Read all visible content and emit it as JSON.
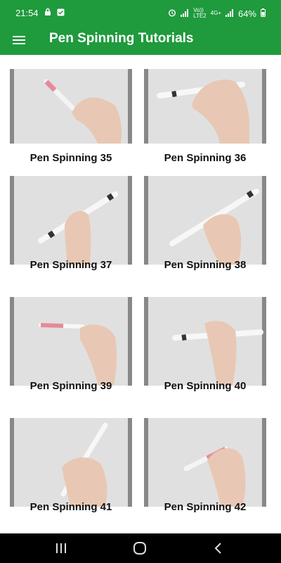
{
  "status_bar": {
    "time": "21:54",
    "network_top": "Vo))",
    "network_bottom": "LTE2",
    "gen_top": "4G+",
    "battery": "64%"
  },
  "app_bar": {
    "title": "Pen Spinning Tutorials",
    "menu_icon": "hamburger-menu-icon"
  },
  "videos": [
    {
      "title": "Pen Spinning 35"
    },
    {
      "title": "Pen Spinning 36"
    },
    {
      "title": "Pen Spinning 37"
    },
    {
      "title": "Pen Spinning 38"
    },
    {
      "title": "Pen Spinning 39"
    },
    {
      "title": "Pen Spinning 40"
    },
    {
      "title": "Pen Spinning 41"
    },
    {
      "title": "Pen Spinning 42"
    }
  ],
  "nav_bar": {
    "recents_icon": "recents-icon",
    "home_icon": "home-icon",
    "back_icon": "back-icon"
  },
  "colors": {
    "primary": "#1f9a3d",
    "thumbnail_bg": "#dcdcdc",
    "nav_bar": "#000000"
  }
}
